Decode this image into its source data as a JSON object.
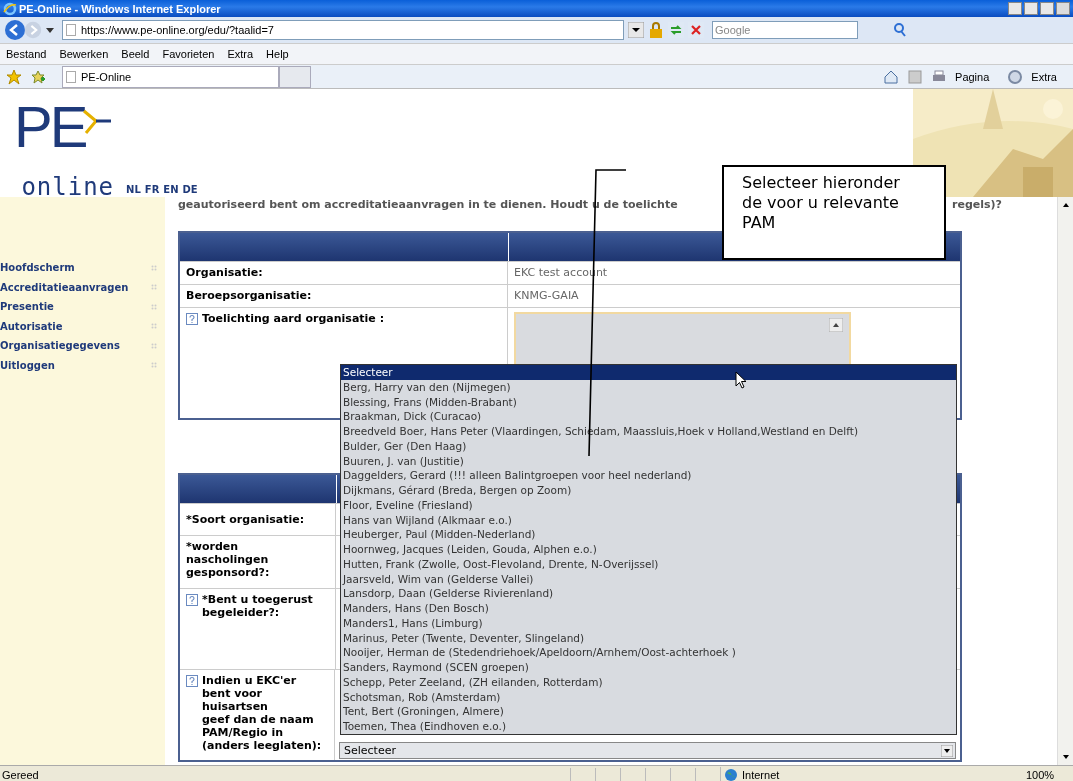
{
  "window": {
    "title": "PE-Online - Windows Internet Explorer"
  },
  "address_bar": {
    "url": "https://www.pe-online.org/edu/?taalid=7",
    "search_placeholder": "Google"
  },
  "menu_bar": [
    "Bestand",
    "Bewerken",
    "Beeld",
    "Favorieten",
    "Extra",
    "Help"
  ],
  "tab": {
    "title": "PE-Online"
  },
  "command_bar": [
    "Pagina",
    "Extra"
  ],
  "header": {
    "logo_top": "PE",
    "logo_bottom": "online",
    "languages": [
      "NL",
      "FR",
      "EN",
      "DE"
    ]
  },
  "intro_fragments": [
    "geautoriseerd bent om accreditatieaanvragen in te dienen. Houdt u de toelichte",
    "regels)?"
  ],
  "sidebar": {
    "items": [
      "Hoofdscherm",
      "Accreditatieaanvragen",
      "Presentie",
      "Autorisatie",
      "Organisatiegegevens",
      "Uitloggen"
    ]
  },
  "table_1": {
    "rows": [
      {
        "kind": "text",
        "label": "Organisatie:",
        "value": "EKC test account",
        "help": false
      },
      {
        "kind": "text",
        "label": "Beroepsorganisatie:",
        "value": "KNMG-GAIA",
        "help": false
      },
      {
        "kind": "textarea",
        "label": "Toelichting aard organisatie :",
        "help": true
      }
    ]
  },
  "table_2": {
    "rows": [
      {
        "kind": "text",
        "label": "*Soort organisatie:",
        "help": false
      },
      {
        "kind": "text",
        "label": "*worden\nnascholingen\ngesponsord?:",
        "help": false
      },
      {
        "kind": "text",
        "label": "*Bent u toegerust\nbegeleider?:",
        "help": true
      },
      {
        "kind": "select",
        "label": "Indien u EKC'er\nbent voor huisartsen\ngeef dan de naam\nPAM/Regio in\n(anders leeglaten):",
        "help": true,
        "value": "Selecteer"
      }
    ]
  },
  "dropdown": {
    "options": [
      {
        "label": "Selecteer",
        "selected": true
      },
      {
        "label": "Berg, Harry van den (Nijmegen)",
        "selected": false
      },
      {
        "label": "Blessing, Frans (Midden-Brabant)",
        "selected": false
      },
      {
        "label": "Braakman, Dick (Curacao)",
        "selected": false
      },
      {
        "label": "Breedveld Boer, Hans Peter (Vlaardingen, Schiedam, Maassluis,Hoek v Holland,Westland en Delft)",
        "selected": false
      },
      {
        "label": "Bulder, Ger (Den Haag)",
        "selected": false
      },
      {
        "label": "Buuren, J. van (Justitie)",
        "selected": false
      },
      {
        "label": "Daggelders, Gerard (!!! alleen Balintgroepen voor heel nederland)",
        "selected": false
      },
      {
        "label": "Dijkmans, Gérard (Breda, Bergen op Zoom)",
        "selected": false
      },
      {
        "label": "Floor, Eveline (Friesland)",
        "selected": false
      },
      {
        "label": "Hans van Wijland (Alkmaar e.o.)",
        "selected": false
      },
      {
        "label": "Heuberger, Paul (Midden-Nederland)",
        "selected": false
      },
      {
        "label": "Hoornweg, Jacques (Leiden, Gouda, Alphen e.o.)",
        "selected": false
      },
      {
        "label": "Hutten, Frank (Zwolle, Oost-Flevoland, Drente, N-Overijssel)",
        "selected": false
      },
      {
        "label": "Jaarsveld, Wim van (Gelderse Vallei)",
        "selected": false
      },
      {
        "label": "Lansdorp, Daan (Gelderse Rivierenland)",
        "selected": false
      },
      {
        "label": "Manders, Hans (Den Bosch)",
        "selected": false
      },
      {
        "label": "Manders1, Hans (Limburg)",
        "selected": false
      },
      {
        "label": "Marinus, Peter (Twente, Deventer, Slingeland)",
        "selected": false
      },
      {
        "label": "Nooijer, Herman de (Stedendriehoek/Apeldoorn/Arnhem/Oost-achterhoek )",
        "selected": false
      },
      {
        "label": "Sanders, Raymond (SCEN groepen)",
        "selected": false
      },
      {
        "label": "Schepp, Peter Zeeland, (ZH eilanden, Rotterdam)",
        "selected": false
      },
      {
        "label": "Schotsman, Rob (Amsterdam)",
        "selected": false
      },
      {
        "label": "Tent, Bert (Groningen, Almere)",
        "selected": false
      },
      {
        "label": "Toemen, Thea (Eindhoven e.o.)",
        "selected": false
      }
    ]
  },
  "callout": {
    "text": "Selecteer hieronder de voor u relevante PAM"
  },
  "status_bar": {
    "status": "Gereed",
    "zone": "Internet",
    "zoom": "100%"
  }
}
